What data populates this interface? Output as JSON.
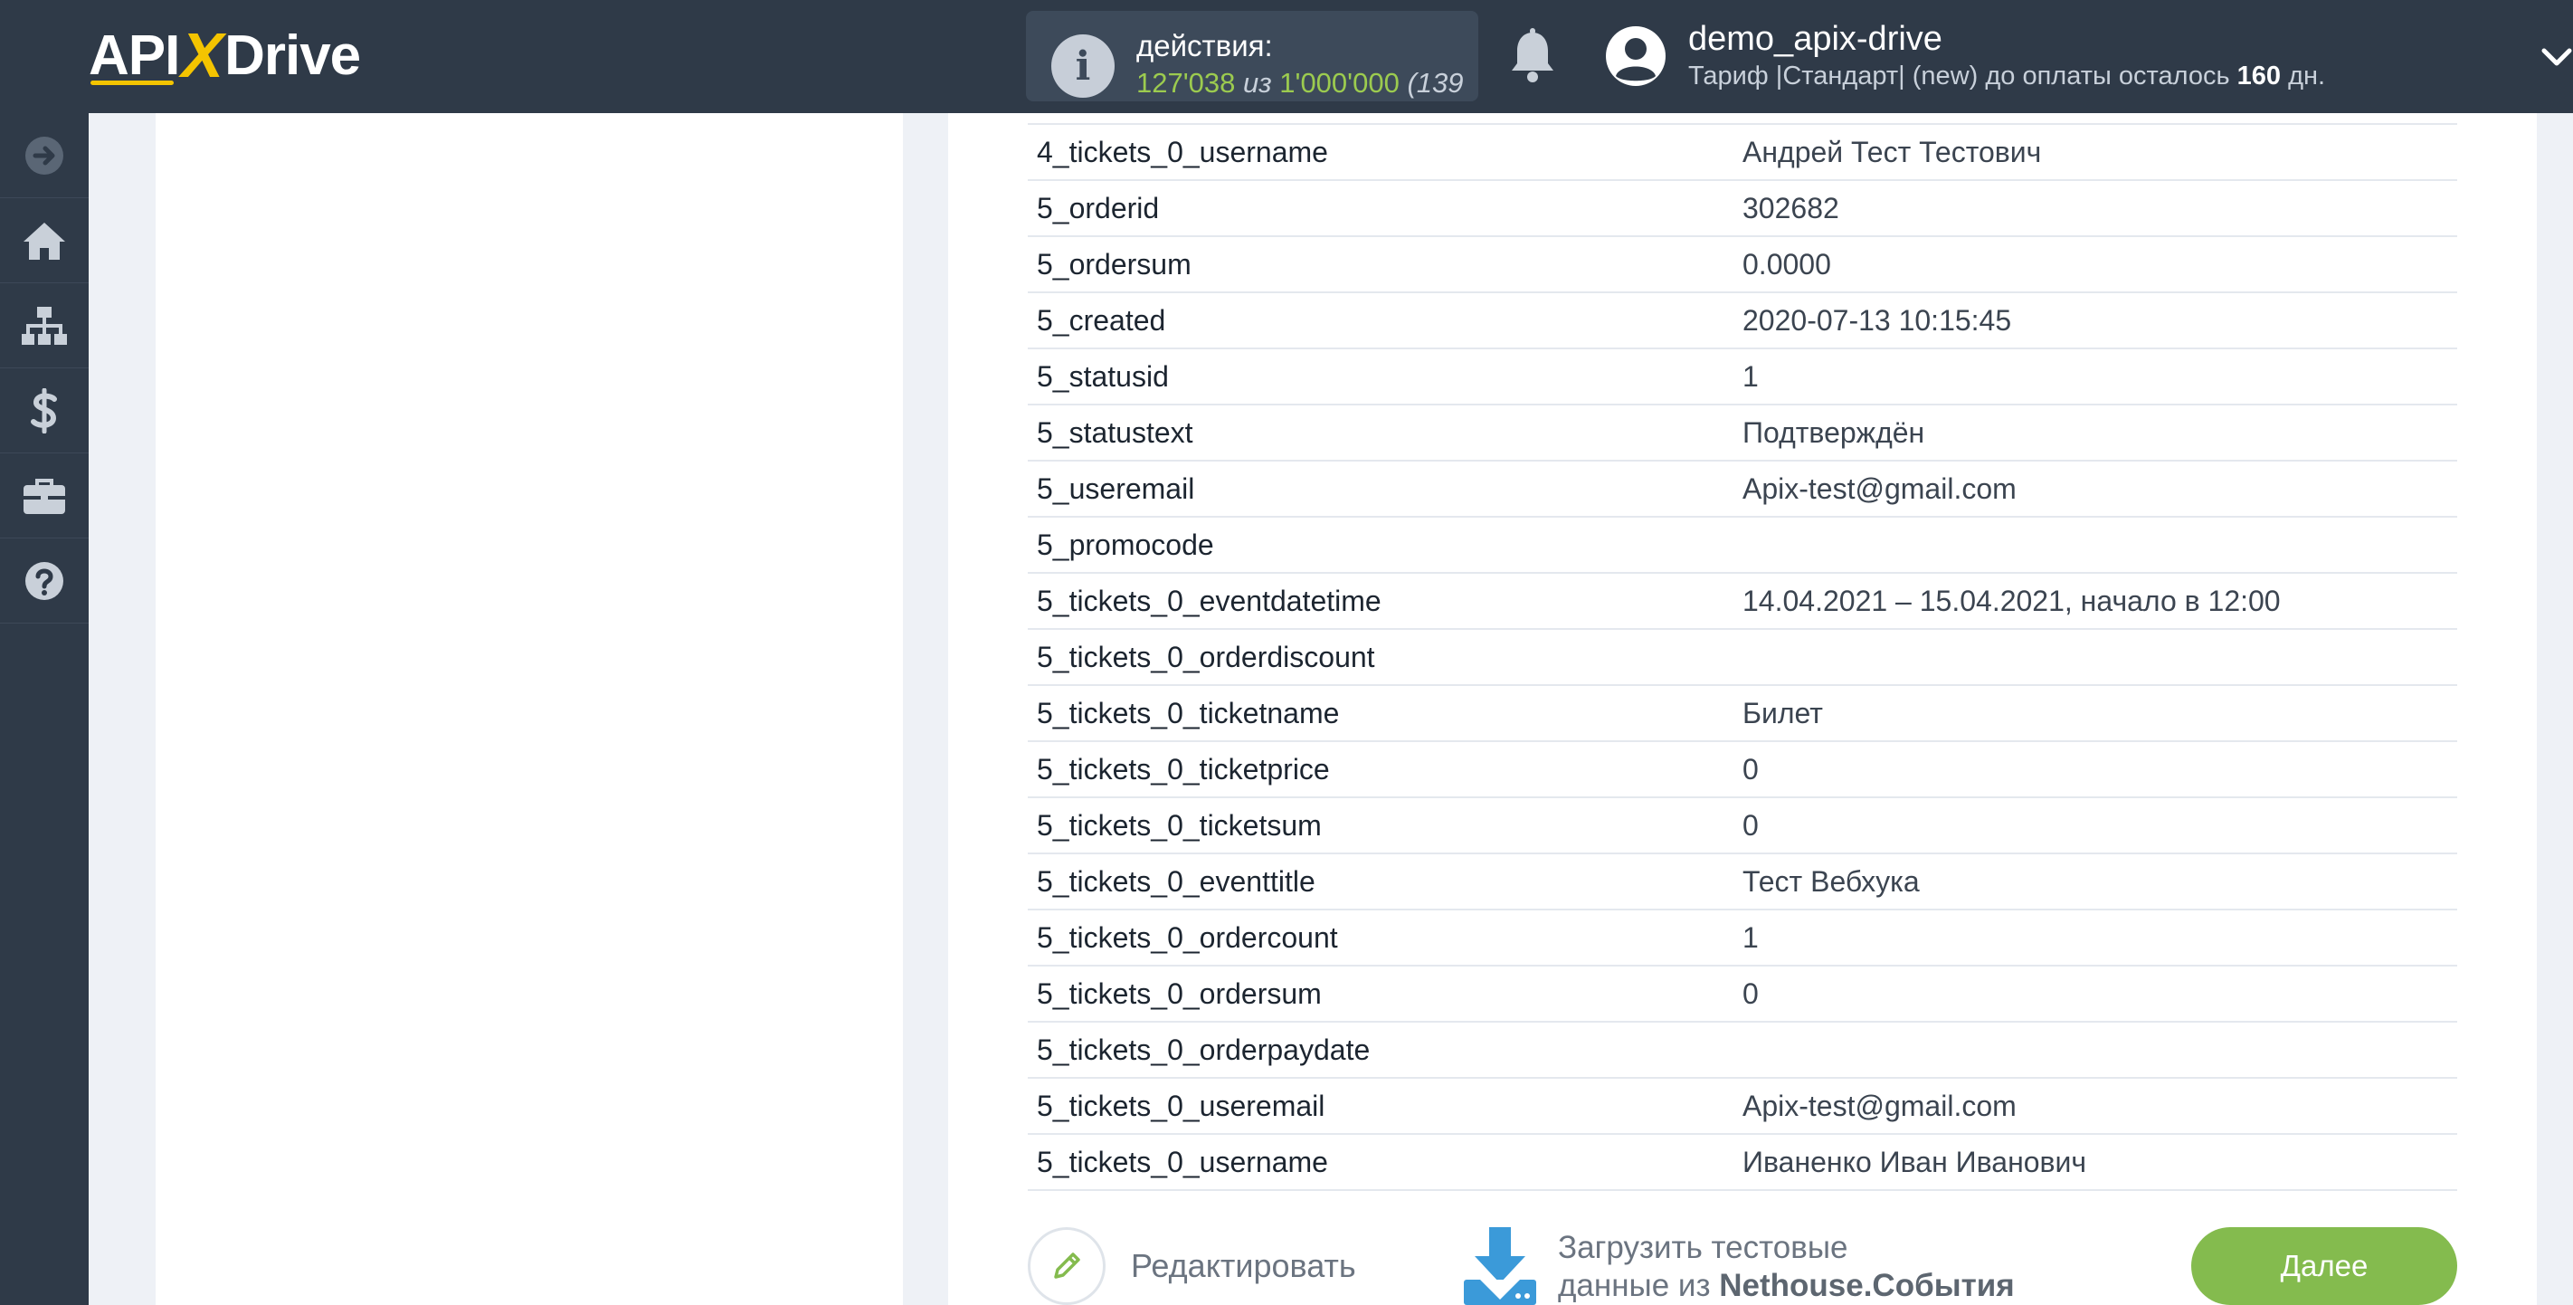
{
  "header": {
    "logo_left": "API",
    "logo_x": "X",
    "logo_right": "Drive",
    "actions_label": "действия:",
    "actions_used": "127'038",
    "actions_of": "из",
    "actions_total": "1'000'000",
    "actions_paren": "(139",
    "username": "demo_apix-drive",
    "plan_text": "Тариф |Стандарт| (new) до оплаты осталось",
    "plan_days": "160",
    "plan_days_unit": "дн."
  },
  "sidebar": {
    "items": [
      "arrow-right-icon",
      "home-icon",
      "sitemap-icon",
      "dollar-icon",
      "briefcase-icon",
      "help-icon"
    ]
  },
  "table": {
    "rows": [
      {
        "key": "4_tickets_0_username",
        "value": "Андрей Тест Тестович"
      },
      {
        "key": "5_orderid",
        "value": "302682"
      },
      {
        "key": "5_ordersum",
        "value": "0.0000"
      },
      {
        "key": "5_created",
        "value": "2020-07-13 10:15:45"
      },
      {
        "key": "5_statusid",
        "value": "1"
      },
      {
        "key": "5_statustext",
        "value": "Подтверждён"
      },
      {
        "key": "5_useremail",
        "value": "Apix-test@gmail.com"
      },
      {
        "key": "5_promocode",
        "value": ""
      },
      {
        "key": "5_tickets_0_eventdatetime",
        "value": "14.04.2021 – 15.04.2021, начало в 12:00"
      },
      {
        "key": "5_tickets_0_orderdiscount",
        "value": ""
      },
      {
        "key": "5_tickets_0_ticketname",
        "value": "Билет"
      },
      {
        "key": "5_tickets_0_ticketprice",
        "value": "0"
      },
      {
        "key": "5_tickets_0_ticketsum",
        "value": "0"
      },
      {
        "key": "5_tickets_0_eventtitle",
        "value": "Тест Вебхука"
      },
      {
        "key": "5_tickets_0_ordercount",
        "value": "1"
      },
      {
        "key": "5_tickets_0_ordersum",
        "value": "0"
      },
      {
        "key": "5_tickets_0_orderpaydate",
        "value": ""
      },
      {
        "key": "5_tickets_0_useremail",
        "value": "Apix-test@gmail.com"
      },
      {
        "key": "5_tickets_0_username",
        "value": "Иваненко Иван Иванович"
      }
    ]
  },
  "footer": {
    "edit_label": "Редактировать",
    "load_line1": "Загрузить тестовые",
    "load_line2_prefix": "данные из",
    "load_line2_source": "Nethouse.События",
    "next_label": "Далее"
  },
  "colors": {
    "header_bg": "#2f3a48",
    "accent_green": "#84bb4e",
    "logo_yellow": "#f4c400",
    "download_blue": "#3b9ad9"
  }
}
